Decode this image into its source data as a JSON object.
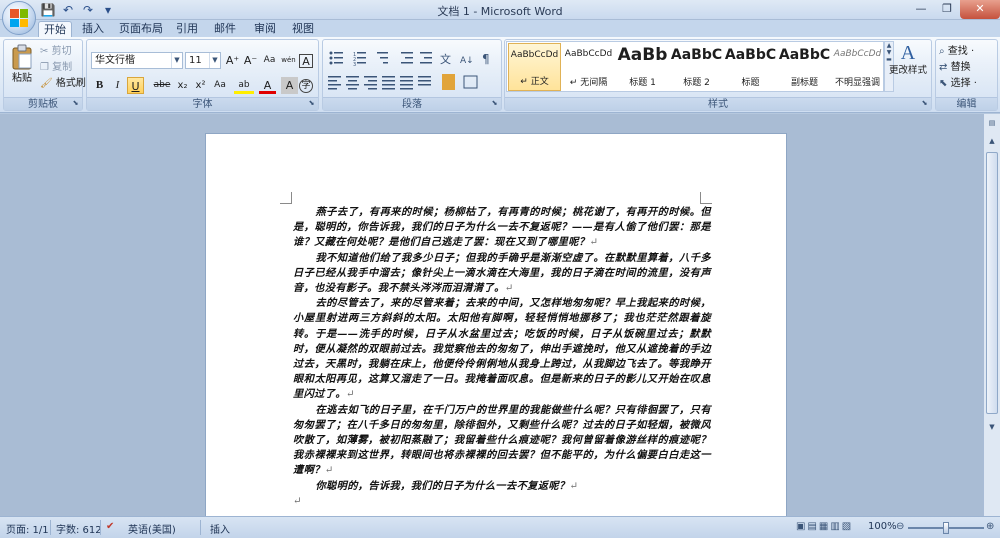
{
  "window": {
    "title": "文档 1 - Microsoft Word",
    "minimize": "—",
    "maximize": "❐",
    "close": "✕"
  },
  "qat": {
    "save": "💾",
    "undo": "↶",
    "redo": "↷",
    "more": "▾"
  },
  "tabs": [
    {
      "label": "开始",
      "active": true
    },
    {
      "label": "插入"
    },
    {
      "label": "页面布局"
    },
    {
      "label": "引用"
    },
    {
      "label": "邮件"
    },
    {
      "label": "审阅"
    },
    {
      "label": "视图"
    }
  ],
  "ribbon": {
    "clipboard": {
      "label": "剪贴板",
      "paste": "粘贴",
      "cut": "剪切",
      "copy": "复制",
      "format_painter": "格式刷"
    },
    "font": {
      "label": "字体",
      "font_name": "华文行楷",
      "font_size": "11",
      "grow": "A⁺",
      "shrink": "A⁻",
      "clear": "Aa",
      "phonetic": "wén",
      "border_char": "A",
      "bold": "B",
      "italic": "I",
      "underline": "U",
      "strike": "abe",
      "subscript": "x₂",
      "superscript": "x²",
      "change_case": "Aa",
      "highlight": "ab",
      "font_color": "A",
      "char_shading": "A",
      "enclose": "字"
    },
    "paragraph": {
      "label": "段落"
    },
    "styles": {
      "label": "样式",
      "items": [
        {
          "sample": "AaBbCcDd",
          "name": "↵ 正文",
          "selected": true
        },
        {
          "sample": "AaBbCcDd",
          "name": "↵ 无间隔"
        },
        {
          "sample": "AaBb",
          "name": "标题 1"
        },
        {
          "sample": "AaBbC",
          "name": "标题 2"
        },
        {
          "sample": "AaBbC",
          "name": "标题"
        },
        {
          "sample": "AaBbC",
          "name": "副标题"
        },
        {
          "sample": "AaBbCcDd",
          "name": "不明显强调"
        }
      ],
      "change_styles": "更改样式"
    },
    "editing": {
      "label": "编辑",
      "find": "查找 ·",
      "replace": "替换",
      "select": "选择 ·"
    }
  },
  "document": {
    "paragraphs": [
      "燕子去了，有再来的时候；杨柳枯了，有再青的时候；桃花谢了，有再开的时候。但是，聪明的，你告诉我，我们的日子为什么一去不复返呢？——是有人偷了他们罢：那是谁？又藏在何处呢？是他们自己逃走了罢：现在又到了哪里呢？",
      "我不知道他们给了我多少日子；但我的手确乎是渐渐空虚了。在默默里算着，八千多日子已经从我手中溜去；像针尖上一滴水滴在大海里，我的日子滴在时间的流里，没有声音，也没有影子。我不禁头涔涔而泪潸潸了。",
      "去的尽管去了，来的尽管来着；去来的中间，又怎样地匆匆呢？早上我起来的时候，小屋里射进两三方斜斜的太阳。太阳他有脚啊，轻轻悄悄地挪移了；我也茫茫然跟着旋转。于是——洗手的时候，日子从水盆里过去；吃饭的时候，日子从饭碗里过去；默默时，便从凝然的双眼前过去。我觉察他去的匆匆了，伸出手遮挽时，他又从遮挽着的手边过去，天黑时，我躺在床上，他便伶伶俐俐地从我身上跨过，从我脚边飞去了。等我睁开眼和太阳再见，这算又溜走了一日。我掩着面叹息。但是新来的日子的影儿又开始在叹息里闪过了。",
      "在逃去如飞的日子里，在千门万户的世界里的我能做些什么呢？只有徘徊罢了，只有匆匆罢了；在八千多日的匆匆里，除徘徊外，又剩些什么呢？过去的日子如轻烟，被微风吹散了，如薄雾，被初阳蒸融了；我留着些什么痕迹呢？我何曾留着像游丝样的痕迹呢？我赤裸裸来到这世界，转眼间也将赤裸裸的回去罢？但不能平的，为什么偏要白白走这一遭啊？",
      "你聪明的，告诉我，我们的日子为什么一去不复返呢？"
    ],
    "para_mark": "↵"
  },
  "statusbar": {
    "page": "页面: 1/1",
    "words": "字数: 612",
    "language": "英语(美国)",
    "insert": "插入",
    "zoom": "100%"
  }
}
